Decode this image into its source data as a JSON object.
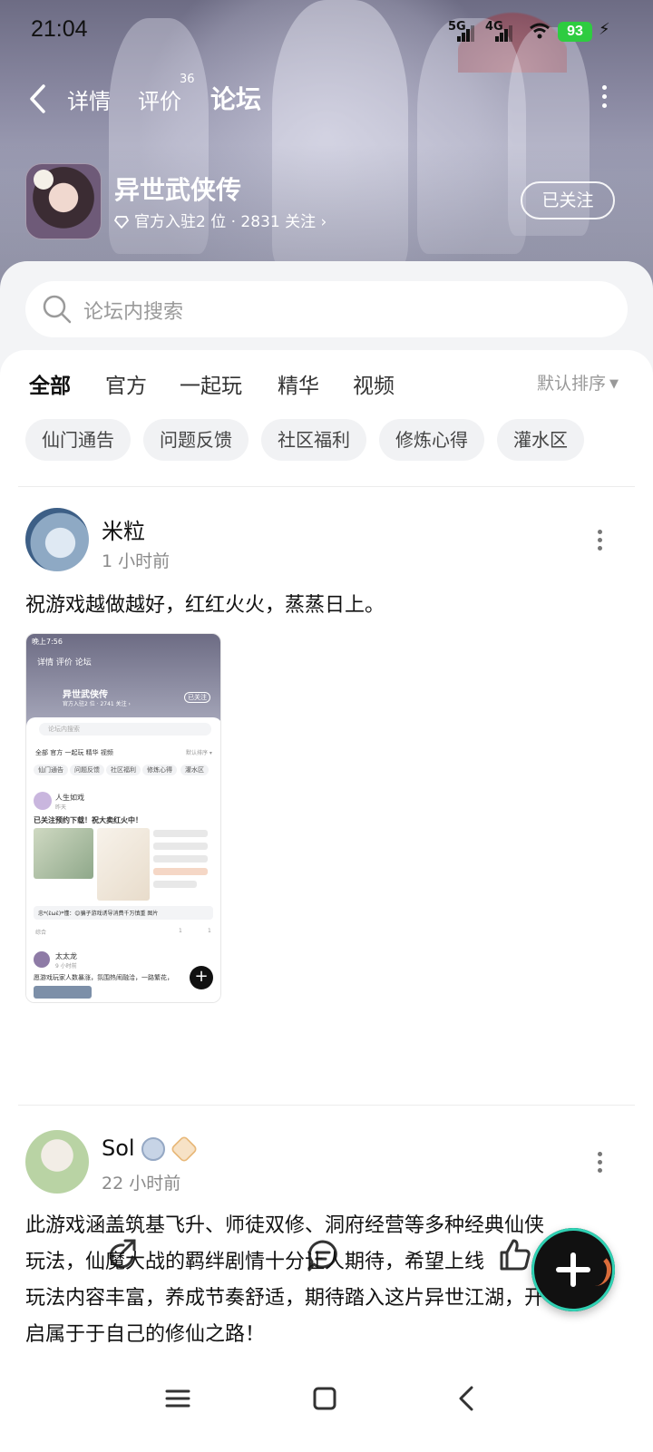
{
  "status_bar": {
    "time": "21:04",
    "net1": "5G",
    "net2": "4G",
    "battery": "93",
    "battery_color": "#2ecc40"
  },
  "nav": {
    "back_icon": "chevron-left-icon",
    "tabs": [
      {
        "label": "详情"
      },
      {
        "label": "评价",
        "badge": "36"
      },
      {
        "label": "论坛",
        "active": true
      }
    ],
    "more_icon": "more-vertical-icon",
    "accent": "#26d0b0"
  },
  "game": {
    "title": "异世武侠传",
    "subtitle": "官方入驻2 位 · 2831 关注 ›",
    "follow_label": "已关注"
  },
  "search": {
    "placeholder": "论坛内搜索"
  },
  "categories": {
    "items": [
      "全部",
      "官方",
      "一起玩",
      "精华",
      "视频"
    ],
    "active": "全部",
    "sort_label": "默认排序"
  },
  "chips": [
    "仙门通告",
    "问题反馈",
    "社区福利",
    "修炼心得",
    "灌水区"
  ],
  "posts": [
    {
      "username": "米粒",
      "time": "1 小时前",
      "text": "祝游戏越做越好，红红火火，蒸蒸日上。",
      "thumb": {
        "time": "晚上7:56",
        "tabs": "详情  评价  论坛",
        "title": "异世武侠传",
        "sub": "官方入驻2 位 · 2741 关注 ›",
        "follow": "已关注",
        "search": "论坛内搜索",
        "cats": "全部   官方   一起玩   精华   视频",
        "sort": "默认排序 ▾",
        "chips": [
          "仙门通告",
          "问题反馈",
          "社区福利",
          "修炼心得",
          "灌水区"
        ],
        "user1": "人生如戏",
        "user1_time": "昨天",
        "post1": "已关注预约下载！祝大卖红火中！",
        "comment": "忠*(ὲωὲ)*懂：😊骗子游戏诱导消费千万慎重  图片",
        "footer_left": "综合",
        "footer_c": "1",
        "footer_l": "1",
        "user2": "太太龙",
        "user2_time": "9 小时前",
        "post2": "愿游戏玩家人数暴涨，氛围热闹融洽，一路繁花，"
      }
    },
    {
      "username": "Sol",
      "time": "22 小时前",
      "text_lines": [
        "此游戏涵盖筑基飞升、师徒双修、洞府经营等多种经典仙侠",
        "玩法，仙魔大战的羁绊剧情十分让人期待，希望上线",
        "玩法内容丰富，养成节奏舒适，期待踏入这片异世江湖，开",
        "启属于于自己的修仙之路！"
      ]
    }
  ],
  "actions": {
    "share_icon": "share-icon",
    "comment_icon": "comment-icon",
    "like_icon": "thumbs-up-icon"
  },
  "fab_icon": "plus-icon",
  "bottom_nav": [
    "menu-icon",
    "home-square-icon",
    "back-chevron-icon"
  ]
}
